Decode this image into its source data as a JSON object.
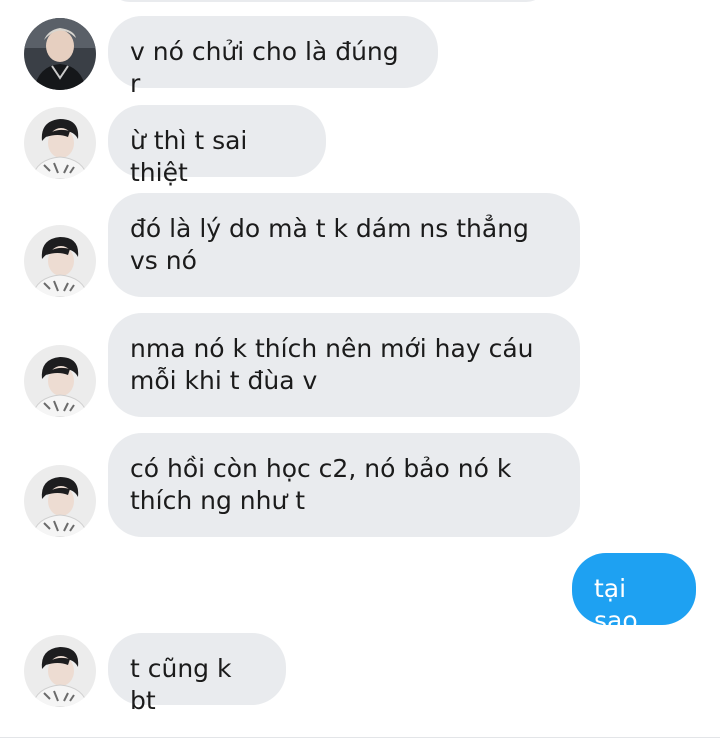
{
  "conversation": {
    "messages": [
      {
        "side": "incoming",
        "avatar": "contact-avatar-a",
        "text": "v nó chửi cho là đúng r"
      },
      {
        "side": "incoming",
        "avatar": "contact-avatar-b",
        "text": "ừ thì t sai thiệt"
      },
      {
        "side": "incoming",
        "avatar": "contact-avatar-b",
        "text": "đó là lý do mà t k dám ns thẳng vs nó"
      },
      {
        "side": "incoming",
        "avatar": "contact-avatar-b",
        "text": "nma nó k thích nên mới hay cáu mỗi khi t đùa v"
      },
      {
        "side": "incoming",
        "avatar": "contact-avatar-b",
        "text": "có hồi còn học c2, nó bảo nó k thích ng như t"
      },
      {
        "side": "outgoing",
        "text": "tại sao"
      },
      {
        "side": "incoming",
        "avatar": "contact-avatar-b",
        "text": "t cũng k bt"
      }
    ]
  },
  "colors": {
    "incoming_bubble": "#e9ebee",
    "outgoing_bubble": "#1ea1f2",
    "incoming_text": "#1b1b1b",
    "outgoing_text": "#ffffff"
  }
}
